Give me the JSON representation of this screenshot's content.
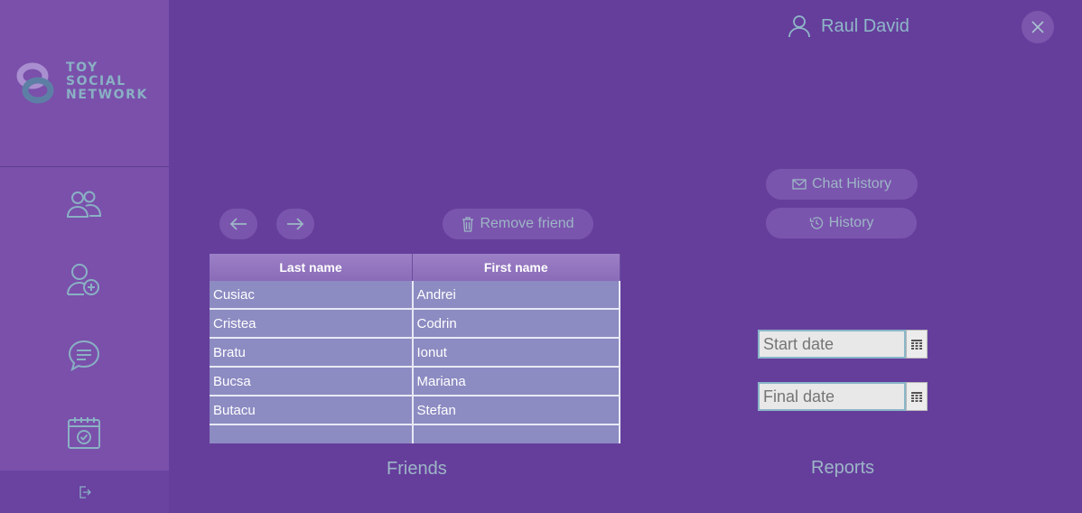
{
  "app": {
    "logo_lines": [
      "TOY",
      "SOCIAL",
      "NETWORK"
    ],
    "user_name": "Raul David"
  },
  "sidebar": {
    "items": [
      {
        "icon": "friends-icon"
      },
      {
        "icon": "add-friend-icon"
      },
      {
        "icon": "messages-icon"
      },
      {
        "icon": "calendar-icon"
      }
    ],
    "logout_icon": "logout-icon"
  },
  "toolbar": {
    "remove_friend_label": "Remove friend",
    "chat_history_label": "Chat History",
    "history_label": "History"
  },
  "friends_table": {
    "columns": [
      "Last name",
      "First name"
    ],
    "rows": [
      [
        "Cusiac",
        "Andrei"
      ],
      [
        "Cristea",
        "Codrin"
      ],
      [
        "Bratu",
        "Ionut"
      ],
      [
        "Bucsa",
        "Mariana"
      ],
      [
        "Butacu",
        "Stefan"
      ],
      [
        "",
        ""
      ]
    ]
  },
  "reports": {
    "start_placeholder": "Start date",
    "final_placeholder": "Final date"
  },
  "sections": {
    "friends_label": "Friends",
    "reports_label": "Reports"
  },
  "colors": {
    "background": "#653e9c",
    "sidebar": "#7a50ab",
    "accent": "#8fb7c8",
    "table": "#8c8bc2"
  }
}
